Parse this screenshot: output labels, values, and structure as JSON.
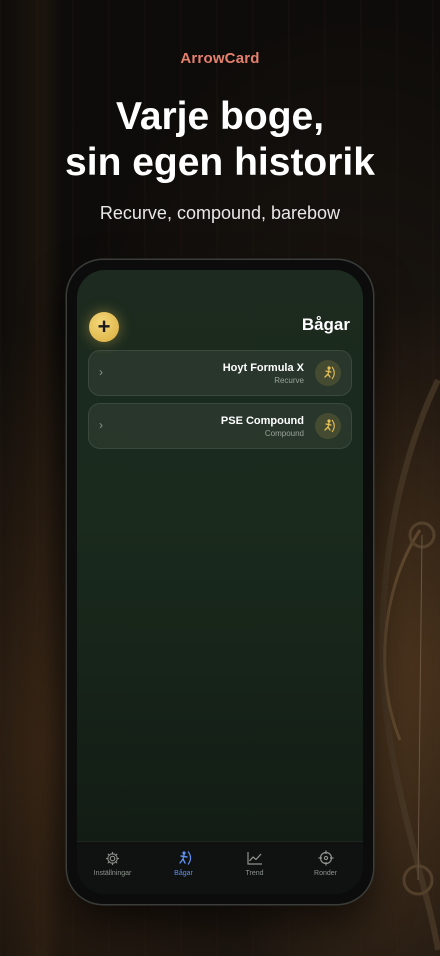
{
  "brand": "ArrowCard",
  "headline": {
    "line1": "Varje boge,",
    "line2": "sin egen historik"
  },
  "subhead": "Recurve, compound, barebow",
  "screen": {
    "title": "Bågar",
    "add_button_label": "+",
    "bows": [
      {
        "name": "Hoyt Formula X",
        "type": "Recurve",
        "icon": "archer-icon"
      },
      {
        "name": "PSE Compound",
        "type": "Compound",
        "icon": "archer-icon"
      }
    ]
  },
  "tabbar": {
    "tabs": [
      {
        "label": "Inställningar",
        "icon": "gear-icon",
        "active": false
      },
      {
        "label": "Bågar",
        "icon": "archer-icon",
        "active": true
      },
      {
        "label": "Trend",
        "icon": "trend-icon",
        "active": false
      },
      {
        "label": "Ronder",
        "icon": "crosshair-icon",
        "active": false
      }
    ]
  },
  "colors": {
    "brand": "#e5806e",
    "accent_gold": "#e6bf55",
    "active_tab": "#5d8ff0",
    "screen_bg": "#1c2a1f"
  }
}
